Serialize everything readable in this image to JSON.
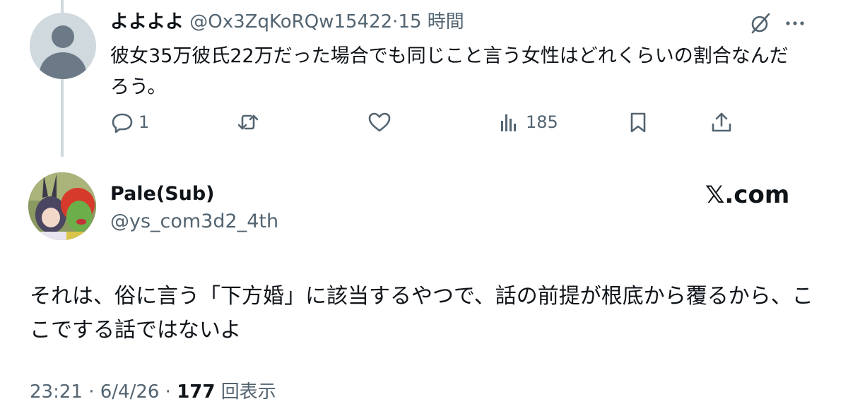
{
  "reply": {
    "name": "よよよよ",
    "handle": "@Ox3ZqKoRQw15422",
    "separator": "·",
    "time": "15 時間",
    "text": "彼女35万彼氏22万だった場合でも同じこと言う女性はどれくらいの割合なんだろう。",
    "actions": {
      "replies": "1",
      "retweets": "",
      "likes": "",
      "views": "185"
    }
  },
  "tweet": {
    "name": "Pale(Sub)",
    "handle": "@ys_com3d2_4th",
    "brand": "𝕏.com",
    "text": "それは、俗に言う「下方婚」に該当するやつで、話の前提が根底から覆るから、ここでする話ではないよ",
    "footer": {
      "time": "23:21 · 6/4/26 · ",
      "views_count": "177",
      "views_label": " 回表示"
    }
  },
  "colors": {
    "text_primary": "#0f1419",
    "text_secondary": "#536471",
    "thread_line": "#cfd9de"
  },
  "icons": [
    "reply-icon",
    "retweet-icon",
    "like-icon",
    "views-icon",
    "bookmark-icon",
    "share-icon",
    "grok-icon",
    "more-icon"
  ]
}
